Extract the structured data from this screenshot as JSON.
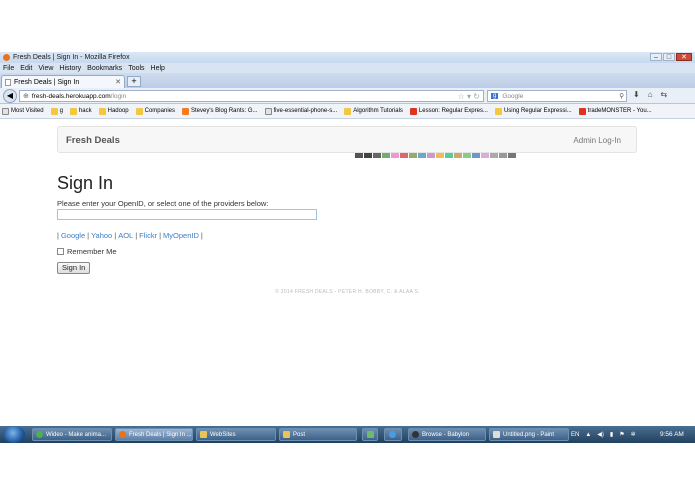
{
  "browser": {
    "window_title": "Fresh Deals | Sign In - Mozilla Firefox",
    "menu": [
      "File",
      "Edit",
      "View",
      "History",
      "Bookmarks",
      "Tools",
      "Help"
    ],
    "tab_title": "Fresh Deals | Sign In",
    "new_tab_label": "+",
    "url_host": "fresh-deals.herokuapp.com",
    "url_path": "/login",
    "search_placeholder": "Google",
    "bookmarks": [
      "Most Visited",
      "g",
      "hack",
      "Hadoop",
      "Companies",
      "Stevey's Blog Rants: G...",
      "five-essential-phone-s...",
      "Algorithm Tutorials",
      "Lesson: Regular Expres...",
      "Using Regular Expressi...",
      "tradeMONSTER - You..."
    ]
  },
  "site": {
    "brand": "Fresh Deals",
    "admin_link": "Admin Log-In"
  },
  "signin": {
    "heading": "Sign In",
    "instructions": "Please enter your OpenID, or select one of the providers below:",
    "providers": [
      "Google",
      "Yahoo",
      "AOL",
      "Flickr",
      "MyOpenID"
    ],
    "separator": "|",
    "remember_label": "Remember Me",
    "button_label": "Sign In"
  },
  "footer": {
    "text": "© 2014 FRESH DEALS - PETER H. BOBBY, C. & ALAA S."
  },
  "taskbar": {
    "items": [
      "Wideo - Make anima...",
      "Fresh Deals | Sign In ...",
      "WebSites",
      "Post",
      "Browse - Babylon",
      "Untitled.png - Paint"
    ],
    "language": "EN",
    "clock": "9:56 AM"
  },
  "colors": {
    "link": "#3b7fc4",
    "taskbar": "#2f5275",
    "navbar_bg": "#f7f7f7"
  }
}
